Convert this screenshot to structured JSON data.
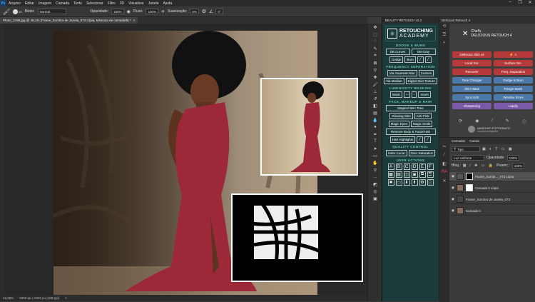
{
  "menubar": {
    "app_icon": "Ps",
    "items": [
      "Arquivo",
      "Editar",
      "Imagem",
      "Camada",
      "Texto",
      "Selecionar",
      "Filtro",
      "3D",
      "Visualizar",
      "Janela",
      "Ajuda"
    ],
    "window_controls": [
      "–",
      "❐",
      "✕"
    ]
  },
  "options": {
    "brush_size": "19",
    "mode_label": "Modo:",
    "mode_value": "Normal",
    "opacity_label": "Opacidade:",
    "opacity_value": "100%",
    "flow_label": "Fluxo:",
    "flow_value": "100%",
    "smoothing_label": "Suavização:",
    "smoothing_value": "0%",
    "angle_value": "0°"
  },
  "document": {
    "tab_title": "Photo_2199.jpg @ 46,1% (Frame_Sombra de Janela_073 cópia, Máscara de camada/8) *",
    "tab_close": "×"
  },
  "status": {
    "zoom": "46,05%",
    "dimensions": "2202 px x 2202 px (180 ppi)",
    "arrow": ">"
  },
  "retouch_panel": {
    "header": "BEAUTY RETOUCH v3.2",
    "logo_line1": "RETOUCHING",
    "logo_line2": "ACADEMY",
    "sections": {
      "dodge_burn": "DODGE & BURN",
      "freq_sep": "FREQUENCY SEPARATION",
      "lum_mask": "LUMINOSITY MASKING",
      "face_makeup": "FACE, MAKEUP & HAIR",
      "quality": "QUALITY CONTROL",
      "user_actions": "USER ACTIONS"
    },
    "buttons": {
      "db_curves": "DB Curves",
      "db_gray": "DB Gray",
      "dodge": "Dodge",
      "burn": "Burn",
      "via_gaussian": "Via Gaussian Blur",
      "custom": "Custom",
      "via_median": "Via Median",
      "digital_skin": "Digital Skin Texture",
      "basic": "Basic",
      "plus": "+",
      "minus": "-",
      "invert": "Invert",
      "magical_skin": "Magical Skin Tone",
      "glowing_skin": "Glowing Skin",
      "anti_pink": "Anti-Pink",
      "magic_eyes": "Magic Eyes",
      "magic_smile": "Magic Smile",
      "remove_body": "Remove Body & Facial Hair",
      "hair_highlights": "Hair Highlights",
      "solar_curve": "Solar Curve",
      "over_saturation": "Over-Saturation"
    },
    "user_letters": [
      "A",
      "B",
      "C",
      "D",
      "E",
      "F"
    ]
  },
  "delicious_panel": {
    "header": "Delicious Retouch 4",
    "chef_line1": "Chef's",
    "chef_line2": "DELICIOUS RETOUCH 4",
    "buttons": [
      "Delicious Skin v4",
      "Local Sm.",
      "Surface Sm.",
      "Remover",
      "Freq. Separation",
      "Tone Changer",
      "Dodge & Burn",
      "Skin Mask",
      "Range Mask",
      "Sync Edit",
      "Window Sizes",
      "Sharpening",
      "Liquify"
    ],
    "signature_name": "ANSELMO FOTÓGRAFO",
    "signature_handle": "/anselmofotografia",
    "colors": {
      "red": "#b73a3a",
      "blue": "#4a78a8",
      "purple": "#7a5aa8"
    }
  },
  "layers_panel": {
    "tabs": [
      "Camadas",
      "Canais"
    ],
    "filter_label": "Tipo",
    "blend_mode": "Luz Unifome",
    "opacity_label": "Opacidade:",
    "opacity_value": "100%",
    "lock_label": "Bloq.:",
    "fill_label": "Preenc.:",
    "fill_value": "100%",
    "layers": [
      {
        "name": "Frame_Sombr..._073 cópia",
        "selected": true
      },
      {
        "name": "Camada 0 cópia",
        "selected": false
      },
      {
        "name": "Frame_Sombra de Janela_073",
        "selected": false
      },
      {
        "name": "Camada 0",
        "selected": false
      }
    ]
  }
}
